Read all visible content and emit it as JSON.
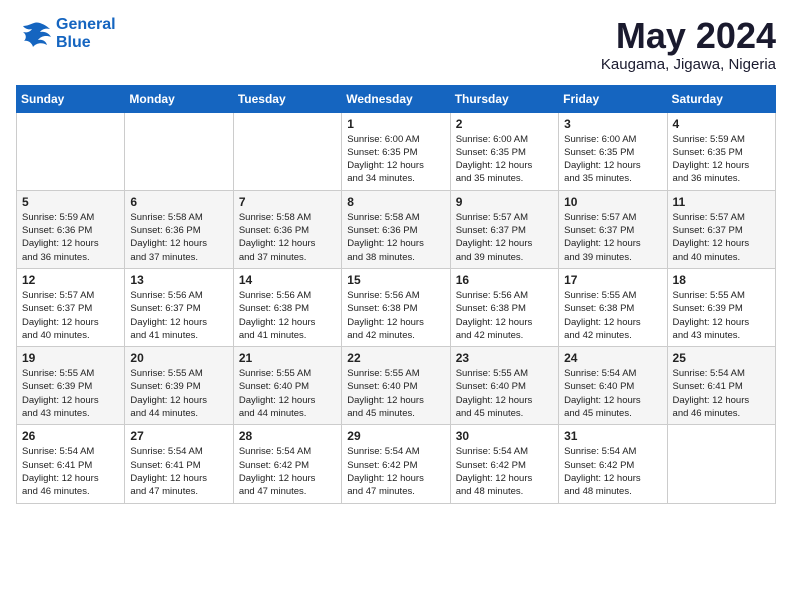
{
  "header": {
    "logo_line1": "General",
    "logo_line2": "Blue",
    "month_title": "May 2024",
    "location": "Kaugama, Jigawa, Nigeria"
  },
  "weekdays": [
    "Sunday",
    "Monday",
    "Tuesday",
    "Wednesday",
    "Thursday",
    "Friday",
    "Saturday"
  ],
  "weeks": [
    [
      {
        "day": "",
        "info": ""
      },
      {
        "day": "",
        "info": ""
      },
      {
        "day": "",
        "info": ""
      },
      {
        "day": "1",
        "info": "Sunrise: 6:00 AM\nSunset: 6:35 PM\nDaylight: 12 hours\nand 34 minutes."
      },
      {
        "day": "2",
        "info": "Sunrise: 6:00 AM\nSunset: 6:35 PM\nDaylight: 12 hours\nand 35 minutes."
      },
      {
        "day": "3",
        "info": "Sunrise: 6:00 AM\nSunset: 6:35 PM\nDaylight: 12 hours\nand 35 minutes."
      },
      {
        "day": "4",
        "info": "Sunrise: 5:59 AM\nSunset: 6:35 PM\nDaylight: 12 hours\nand 36 minutes."
      }
    ],
    [
      {
        "day": "5",
        "info": "Sunrise: 5:59 AM\nSunset: 6:36 PM\nDaylight: 12 hours\nand 36 minutes."
      },
      {
        "day": "6",
        "info": "Sunrise: 5:58 AM\nSunset: 6:36 PM\nDaylight: 12 hours\nand 37 minutes."
      },
      {
        "day": "7",
        "info": "Sunrise: 5:58 AM\nSunset: 6:36 PM\nDaylight: 12 hours\nand 37 minutes."
      },
      {
        "day": "8",
        "info": "Sunrise: 5:58 AM\nSunset: 6:36 PM\nDaylight: 12 hours\nand 38 minutes."
      },
      {
        "day": "9",
        "info": "Sunrise: 5:57 AM\nSunset: 6:37 PM\nDaylight: 12 hours\nand 39 minutes."
      },
      {
        "day": "10",
        "info": "Sunrise: 5:57 AM\nSunset: 6:37 PM\nDaylight: 12 hours\nand 39 minutes."
      },
      {
        "day": "11",
        "info": "Sunrise: 5:57 AM\nSunset: 6:37 PM\nDaylight: 12 hours\nand 40 minutes."
      }
    ],
    [
      {
        "day": "12",
        "info": "Sunrise: 5:57 AM\nSunset: 6:37 PM\nDaylight: 12 hours\nand 40 minutes."
      },
      {
        "day": "13",
        "info": "Sunrise: 5:56 AM\nSunset: 6:37 PM\nDaylight: 12 hours\nand 41 minutes."
      },
      {
        "day": "14",
        "info": "Sunrise: 5:56 AM\nSunset: 6:38 PM\nDaylight: 12 hours\nand 41 minutes."
      },
      {
        "day": "15",
        "info": "Sunrise: 5:56 AM\nSunset: 6:38 PM\nDaylight: 12 hours\nand 42 minutes."
      },
      {
        "day": "16",
        "info": "Sunrise: 5:56 AM\nSunset: 6:38 PM\nDaylight: 12 hours\nand 42 minutes."
      },
      {
        "day": "17",
        "info": "Sunrise: 5:55 AM\nSunset: 6:38 PM\nDaylight: 12 hours\nand 42 minutes."
      },
      {
        "day": "18",
        "info": "Sunrise: 5:55 AM\nSunset: 6:39 PM\nDaylight: 12 hours\nand 43 minutes."
      }
    ],
    [
      {
        "day": "19",
        "info": "Sunrise: 5:55 AM\nSunset: 6:39 PM\nDaylight: 12 hours\nand 43 minutes."
      },
      {
        "day": "20",
        "info": "Sunrise: 5:55 AM\nSunset: 6:39 PM\nDaylight: 12 hours\nand 44 minutes."
      },
      {
        "day": "21",
        "info": "Sunrise: 5:55 AM\nSunset: 6:40 PM\nDaylight: 12 hours\nand 44 minutes."
      },
      {
        "day": "22",
        "info": "Sunrise: 5:55 AM\nSunset: 6:40 PM\nDaylight: 12 hours\nand 45 minutes."
      },
      {
        "day": "23",
        "info": "Sunrise: 5:55 AM\nSunset: 6:40 PM\nDaylight: 12 hours\nand 45 minutes."
      },
      {
        "day": "24",
        "info": "Sunrise: 5:54 AM\nSunset: 6:40 PM\nDaylight: 12 hours\nand 45 minutes."
      },
      {
        "day": "25",
        "info": "Sunrise: 5:54 AM\nSunset: 6:41 PM\nDaylight: 12 hours\nand 46 minutes."
      }
    ],
    [
      {
        "day": "26",
        "info": "Sunrise: 5:54 AM\nSunset: 6:41 PM\nDaylight: 12 hours\nand 46 minutes."
      },
      {
        "day": "27",
        "info": "Sunrise: 5:54 AM\nSunset: 6:41 PM\nDaylight: 12 hours\nand 47 minutes."
      },
      {
        "day": "28",
        "info": "Sunrise: 5:54 AM\nSunset: 6:42 PM\nDaylight: 12 hours\nand 47 minutes."
      },
      {
        "day": "29",
        "info": "Sunrise: 5:54 AM\nSunset: 6:42 PM\nDaylight: 12 hours\nand 47 minutes."
      },
      {
        "day": "30",
        "info": "Sunrise: 5:54 AM\nSunset: 6:42 PM\nDaylight: 12 hours\nand 48 minutes."
      },
      {
        "day": "31",
        "info": "Sunrise: 5:54 AM\nSunset: 6:42 PM\nDaylight: 12 hours\nand 48 minutes."
      },
      {
        "day": "",
        "info": ""
      }
    ]
  ]
}
